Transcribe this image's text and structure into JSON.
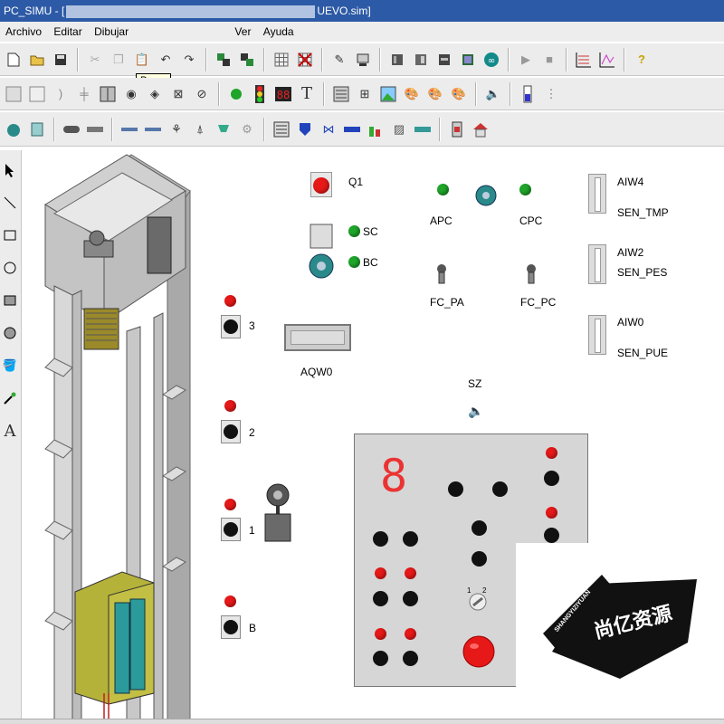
{
  "window": {
    "title_prefix": "PC_SIMU - [",
    "title_suffix": "UEVO.sim]"
  },
  "menu": [
    "Archivo",
    "Editar",
    "Dibujar",
    "Ver",
    "Ayuda"
  ],
  "tooltip": "Pegar",
  "toolbar1": [
    "new-file",
    "open-folder",
    "save",
    "cut",
    "copy",
    "paste",
    "undo",
    "redo",
    "bring-front",
    "send-back",
    "grid",
    "no-grid",
    "pencil",
    "device",
    "block-a",
    "block-b",
    "block-c",
    "block-d",
    "arduino",
    "run",
    "stop",
    "chart-a",
    "chart-b",
    "help"
  ],
  "toolbar2": [
    "comp-a",
    "comp-b",
    "comp-c",
    "comp-d",
    "comp-e",
    "comp-f",
    "comp-g",
    "comp-h",
    "comp-i",
    "green-lamp",
    "traffic-light",
    "seven-seg",
    "text-tool",
    "comp-j",
    "comp-k",
    "image",
    "palette",
    "palette-in",
    "palette-out",
    "speaker",
    "sensor-a",
    "sensor-b"
  ],
  "toolbar3": [
    "motor",
    "cylinder",
    "conveyor",
    "comp-l",
    "comp-m",
    "comp-n",
    "comp-o",
    "comp-p",
    "comp-q",
    "gear",
    "panel",
    "comp-r",
    "valve",
    "pipe",
    "flask",
    "stripes",
    "comp-s",
    "comp-t",
    "house"
  ],
  "left_tools": [
    "arrow-icon",
    "line-icon",
    "rect-icon",
    "ellipse-icon",
    "filled-rect-icon",
    "filled-ellipse-icon",
    "fill-icon",
    "picker-icon",
    "text-icon"
  ],
  "left_text_tool": "A",
  "labels": {
    "q1": "Q1",
    "sc": "SC",
    "bc": "BC",
    "apc": "APC",
    "cpc": "CPC",
    "fc_pa": "FC_PA",
    "fc_pc": "FC_PC",
    "aqw0": "AQW0",
    "sz": "SZ",
    "aiw4": "AIW4",
    "sen_tmp": "SEN_TMP",
    "aiw2": "AIW2",
    "sen_pes": "SEN_PES",
    "aiw0": "AIW0",
    "sen_pue": "SEN_PUE",
    "floor3": "3",
    "floor2": "2",
    "floor1": "1",
    "floorB": "B"
  },
  "panel": {
    "display_digit": "8",
    "selector_labels": [
      "1",
      "2"
    ]
  },
  "watermark": {
    "text_main": "尚亿资源",
    "text_sub": "SHANGYIZIYUAN"
  },
  "colors": {
    "title_bar": "#2d5aa6",
    "lamp_red": "#e61818",
    "lamp_green": "#1fa52a",
    "panel_bg": "#d6d6d6",
    "cabin": "#b5b23a"
  }
}
